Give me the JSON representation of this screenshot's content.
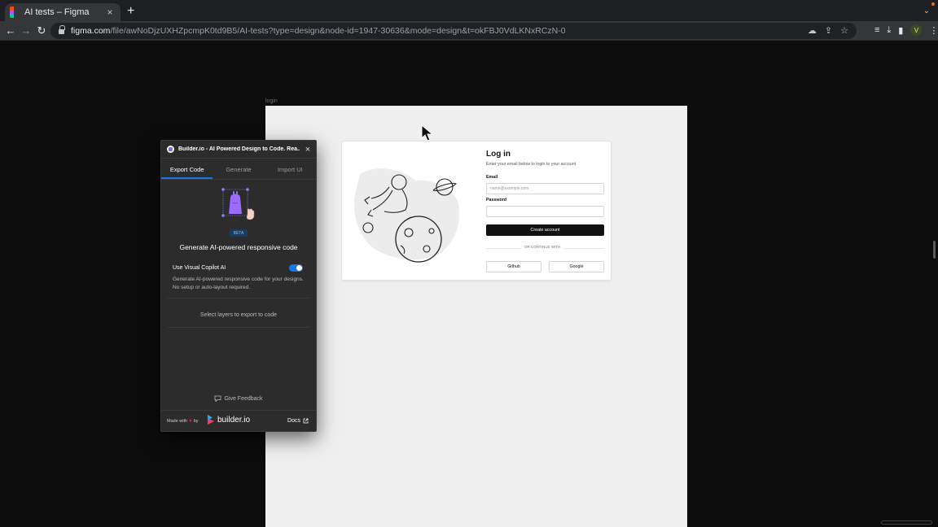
{
  "browser": {
    "tab_title": "AI tests – Figma",
    "tab_close": "×",
    "new_tab": "+",
    "url_host": "figma.com",
    "url_path": "/file/awNoDjzUXHZpcmpK0td9B5/AI-tests?type=design&node-id=1947-30636&mode=design&t=okFBJ0VdLKNxRCzN-0",
    "profile_initial": "V"
  },
  "canvas": {
    "frame_label": "login"
  },
  "login": {
    "title": "Log in",
    "subtitle": "Enter your email below to login to your account",
    "email_label": "Email",
    "email_placeholder": "name@example.com",
    "password_label": "Password",
    "password_placeholder": "",
    "primary_button": "Create account",
    "divider_text": "OR CONTINUE WITH",
    "github_button": "Github",
    "google_button": "Google"
  },
  "plugin": {
    "title": "Builder.io - AI Powered Design to Code. Rea...",
    "close": "×",
    "tabs": [
      {
        "label": "Export Code",
        "active": true
      },
      {
        "label": "Generate",
        "active": false
      },
      {
        "label": "Import UI",
        "active": false
      }
    ],
    "badge": "BETA",
    "heading": "Generate AI-powered responsive code",
    "toggle_label": "Use Visual Copilot AI",
    "toggle_on": true,
    "toggle_description": "Generate AI-powered responsive code for your designs. No setup or auto-layout required.",
    "empty_state": "Select layers to export to code",
    "feedback": "Give Feedback",
    "made_with": "Made with",
    "by": "by",
    "brand": "builder.io",
    "docs": "Docs"
  },
  "colors": {
    "accent": "#1a73e8",
    "canvas_bg": "#0c0c0c",
    "panel_bg": "#2c2c2c"
  }
}
